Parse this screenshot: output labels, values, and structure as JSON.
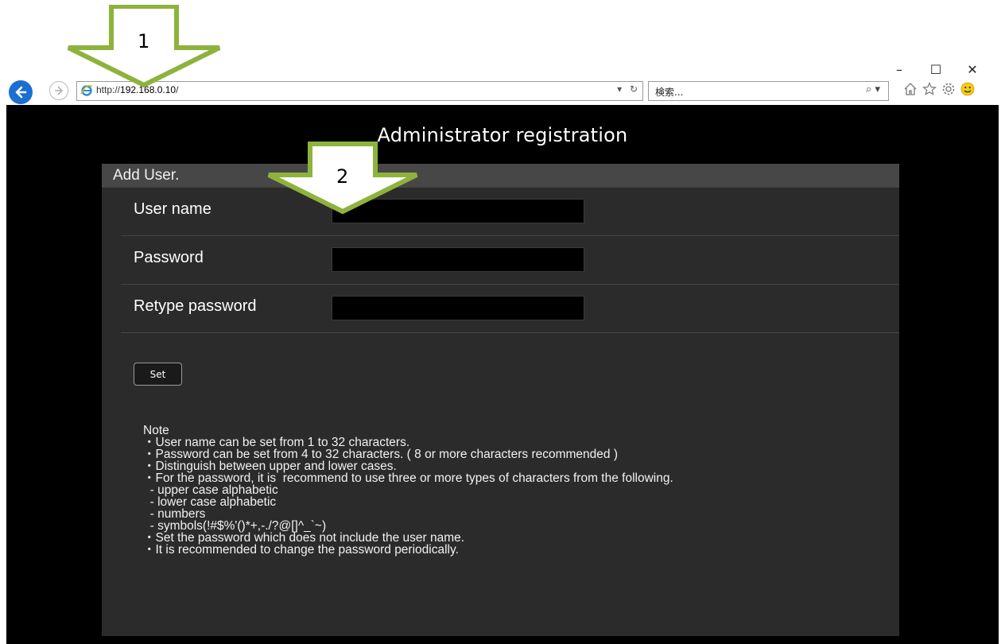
{
  "window": {
    "controls": {
      "minimize": "–",
      "maximize": "☐",
      "close": "✕"
    }
  },
  "browser": {
    "url_scheme": "http://",
    "url_host": "192.168.0.10",
    "url_path": "/",
    "dropdown_glyph": "▾",
    "refresh_glyph": "↻",
    "search_placeholder": "検索...",
    "search_glyph": "⌕",
    "search_dropdown_glyph": "▾",
    "tool_icons": [
      "home-icon",
      "favorites-icon",
      "settings-icon",
      "feedback-smiley-icon"
    ]
  },
  "annotations": {
    "arrow1": "1",
    "arrow2": "2"
  },
  "page": {
    "title": "Administrator registration",
    "panel_title": "Add User.",
    "fields": [
      {
        "label": "User name",
        "value": ""
      },
      {
        "label": "Password",
        "value": ""
      },
      {
        "label": "Retype password",
        "value": ""
      }
    ],
    "set_label": "Set",
    "note": {
      "heading": "Note",
      "lines": [
        "・User name can be set from 1 to 32 characters.",
        "・Password can be set from 4 to 32 characters. ( 8 or more characters recommended )",
        "・Distinguish between upper and lower cases.",
        "・For the password, it is  recommend to use three or more types of characters from the following.",
        "  - upper case alphabetic",
        "  - lower case alphabetic",
        "  - numbers",
        "  - symbols(!#$%'()*+,-./?@[]^_`~)",
        "・Set the password which does not include the user name.",
        "・It is recommended to change the password periodically."
      ]
    }
  },
  "colors": {
    "page_bg": "#000000",
    "panel_bg": "#2b2b2b",
    "panel_header_bg": "#474747",
    "arrow_fill": "#ffffff",
    "arrow_stroke": "#8db33c",
    "back_button": "#1a6fd1"
  }
}
